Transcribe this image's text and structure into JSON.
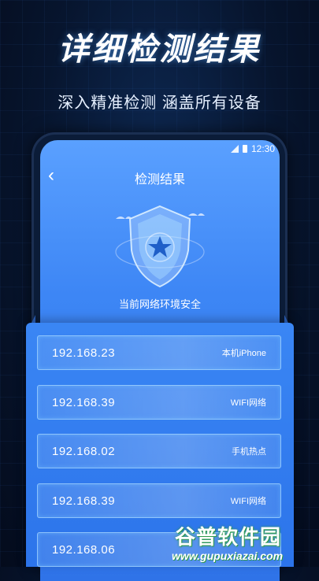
{
  "promo": {
    "title": "详细检测结果",
    "subtitle": "深入精准检测 涵盖所有设备"
  },
  "status_bar": {
    "time": "12:30"
  },
  "nav": {
    "back_icon": "chevron-left-icon",
    "title": "检测结果"
  },
  "result": {
    "status_text": "当前网络环境安全",
    "shield_icon": "shield-star-icon"
  },
  "devices": [
    {
      "ip": "192.168.23",
      "label": "本机iPhone"
    },
    {
      "ip": "192.168.39",
      "label": "WIFI网络"
    },
    {
      "ip": "192.168.02",
      "label": "手机热点"
    },
    {
      "ip": "192.168.39",
      "label": "WIFI网络"
    },
    {
      "ip": "192.168.06",
      "label": ""
    }
  ],
  "watermark": {
    "title": "谷普软件园",
    "url": "www.gupuxiazai.com"
  },
  "colors": {
    "accent": "#3d86f5",
    "background": "#07152e",
    "watermark_green": "#2e9a4a"
  }
}
